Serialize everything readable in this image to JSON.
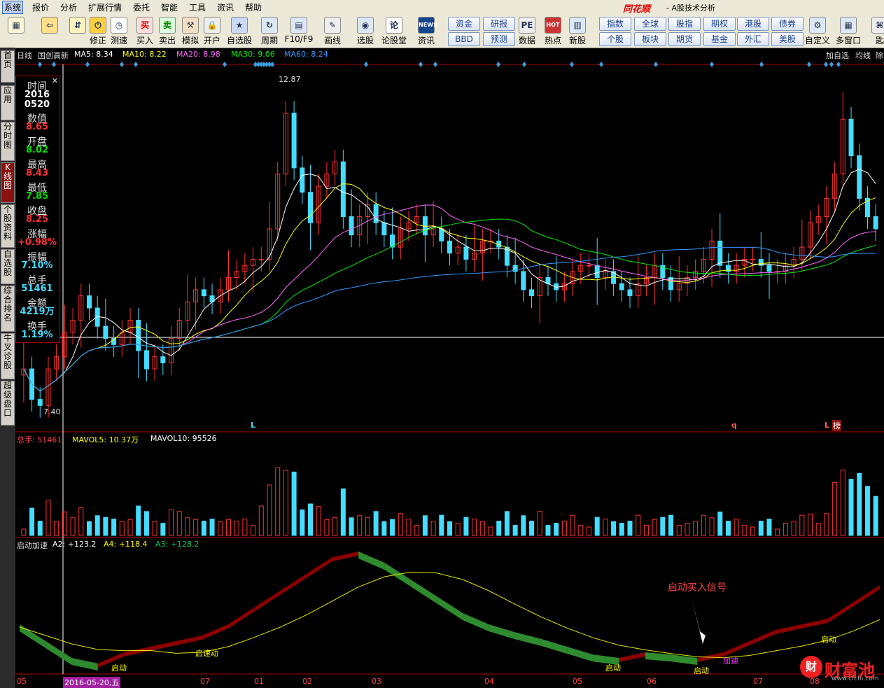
{
  "menu": {
    "items": [
      "系统",
      "报价",
      "分析",
      "扩展行情",
      "委托",
      "智能",
      "工具",
      "资讯",
      "帮助"
    ],
    "brand": "同花顺",
    "subtitle": "- A股技术分析"
  },
  "toolbar": {
    "tools": [
      {
        "label": "",
        "icon": "grid-icon"
      },
      {
        "label": "",
        "icon": "back-arrow-icon"
      },
      {
        "label": "",
        "icon": "up-down-icon"
      },
      {
        "label": "修正",
        "icon": "power-icon"
      },
      {
        "label": "测速",
        "icon": "clock-icon"
      },
      {
        "label": "买入",
        "icon": "buy-icon",
        "glyph": "买"
      },
      {
        "label": "卖出",
        "icon": "sell-icon",
        "glyph": "卖"
      },
      {
        "label": "模拟",
        "icon": "hammer-icon"
      },
      {
        "label": "开户",
        "icon": "lock-icon"
      },
      {
        "label": "自选股",
        "icon": "star-icon"
      },
      {
        "label": "周期",
        "icon": "cycle-icon"
      },
      {
        "label": "F10/F9",
        "icon": "f10-icon"
      },
      {
        "label": "画线",
        "icon": "pen-icon"
      },
      {
        "label": "选股",
        "icon": "select-icon"
      },
      {
        "label": "论股堂",
        "icon": "forum-icon",
        "glyph": "论"
      },
      {
        "label": "资讯",
        "icon": "news-icon",
        "glyph": "NEWS"
      },
      {
        "label": "数据",
        "icon": "pe-icon",
        "glyph": "PE"
      },
      {
        "label": "热点",
        "icon": "hot-icon",
        "glyph": "HOT"
      },
      {
        "label": "新股",
        "icon": "newstock-icon"
      },
      {
        "label": "自定义",
        "icon": "custom-icon"
      },
      {
        "label": "多窗口",
        "icon": "multiwindow-icon"
      },
      {
        "label": "匙",
        "icon": "key-icon"
      }
    ],
    "grid_buttons": [
      [
        "资金",
        "研报"
      ],
      [
        "BBD",
        "预测"
      ]
    ],
    "market_buttons": [
      [
        "指数",
        "全球",
        "股指",
        "期权",
        "港股",
        "债券"
      ],
      [
        "个股",
        "板块",
        "期货",
        "基金",
        "外汇",
        "美股"
      ]
    ]
  },
  "sidetabs": [
    "首页",
    "应用",
    "分时图",
    "K线图",
    "个股资料",
    "自选股",
    "综合排名",
    "牛叉诊股",
    "超级盘口"
  ],
  "chart_header": {
    "period": "日线",
    "name": "国创高新",
    "ma5": "MA5: 8.34",
    "ma10": "MA10: 8.22",
    "ma20": "MA20: 8.98",
    "ma30": "MA30: 9.06",
    "ma60": "MA60: 8.24",
    "add_watch": "加自选",
    "avg_line": "均线",
    "exclude": "除"
  },
  "info": {
    "rows": [
      {
        "label": "时间",
        "value": "2016\n0520",
        "cls": "wh"
      },
      {
        "label": "数值",
        "value": "8.65",
        "cls": "red"
      },
      {
        "label": "开盘",
        "value": "8.02",
        "cls": "grn"
      },
      {
        "label": "最高",
        "value": "8.43",
        "cls": "red"
      },
      {
        "label": "最低",
        "value": "7.85",
        "cls": "grn"
      },
      {
        "label": "收盘",
        "value": "8.25",
        "cls": "red"
      },
      {
        "label": "涨幅",
        "value": "+0.98%",
        "cls": "red"
      },
      {
        "label": "振幅",
        "value": "7.10%",
        "cls": "cy"
      },
      {
        "label": "总手",
        "value": "51461",
        "cls": "cy"
      },
      {
        "label": "金额",
        "value": "4219万",
        "cls": "cy"
      },
      {
        "label": "换手",
        "value": "1.19%",
        "cls": "cy"
      }
    ]
  },
  "price_labels": {
    "high": "12.87",
    "low": "7.40",
    "markers": [
      "L",
      "q",
      "L"
    ],
    "badge": "榜"
  },
  "volume_header": {
    "total": "总手: 51461",
    "mavol5": "MAVOL5: 10.37万",
    "mavol10": "MAVOL10: 95526"
  },
  "indicator_header": {
    "name": "启动加速",
    "a2": "A2: +123.2",
    "a4": "A4: +118.4",
    "a3": "A3: +128.2"
  },
  "indicator_labels": {
    "signal": "启动买入信号",
    "start": "启动",
    "accel": "加速",
    "start_accel": "启速动"
  },
  "xaxis": {
    "labels": [
      "05",
      "07",
      "01",
      "02",
      "03",
      "04",
      "05",
      "06",
      "07",
      "08"
    ],
    "cursor_date": "2016-05-20,五"
  },
  "watermark": {
    "text": "财富池",
    "url": "www.cfchi.com"
  },
  "colors": {
    "up": "#ff3333",
    "down": "#44ddff",
    "ma5": "#ffffff",
    "ma10": "#ffff00",
    "ma20": "#ff66ff",
    "ma30": "#00ee00",
    "ma60": "#3399ff",
    "ind_up": "#8b0000",
    "ind_down": "#2e8b2e",
    "ind_line": "#e6e600"
  },
  "chart_data": {
    "type": "candlestick",
    "price_range": [
      7.4,
      12.87
    ],
    "closes": [
      8.1,
      7.6,
      7.5,
      8.1,
      8.3,
      8.7,
      8.9,
      9.3,
      9.1,
      8.8,
      8.6,
      8.5,
      8.7,
      8.9,
      8.4,
      8.1,
      8.3,
      8.2,
      8.6,
      8.9,
      9.2,
      9.4,
      9.3,
      9.2,
      9.4,
      9.6,
      9.7,
      9.8,
      9.9,
      9.9,
      10.4,
      11.3,
      12.3,
      11.4,
      11.0,
      10.5,
      11.1,
      11.3,
      11.5,
      10.6,
      10.3,
      10.6,
      10.8,
      10.5,
      10.3,
      10.1,
      10.4,
      10.5,
      10.6,
      10.3,
      10.4,
      10.2,
      10.0,
      10.1,
      9.9,
      10.0,
      10.2,
      10.2,
      10.1,
      9.8,
      9.7,
      9.4,
      9.3,
      9.6,
      9.5,
      9.4,
      9.5,
      9.7,
      9.8,
      9.8,
      9.6,
      9.7,
      9.5,
      9.4,
      9.3,
      9.5,
      9.6,
      9.8,
      9.6,
      9.4,
      9.5,
      9.6,
      9.7,
      9.9,
      10.2,
      9.8,
      9.7,
      9.8,
      9.9,
      9.9,
      9.8,
      9.7,
      9.7,
      9.8,
      9.9,
      10.1,
      10.5,
      10.6,
      10.9,
      11.3,
      12.2,
      11.6,
      10.9,
      10.6,
      10.4
    ]
  }
}
